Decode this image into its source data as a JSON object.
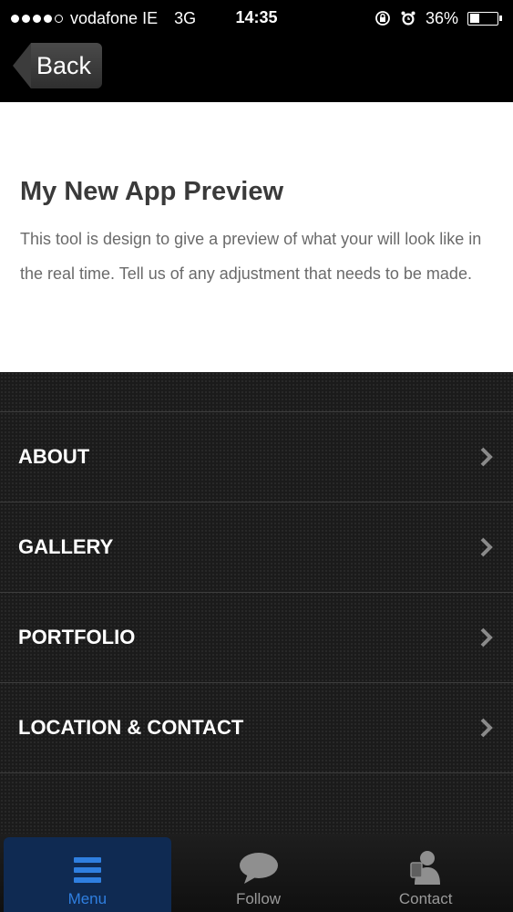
{
  "status_bar": {
    "carrier": "vodafone IE",
    "network": "3G",
    "time": "14:35",
    "battery": "36%",
    "battery_level": 0.36
  },
  "nav": {
    "back_label": "Back"
  },
  "intro": {
    "title": "My New App Preview",
    "body": "This tool is design to give a preview of what your will look like in the real time. Tell us of any adjustment that needs to be made."
  },
  "menu": {
    "items": [
      {
        "label": "ABOUT",
        "icon": "chevron-right-icon"
      },
      {
        "label": "GALLERY",
        "icon": "chevron-right-icon"
      },
      {
        "label": "PORTFOLIO",
        "icon": "chevron-right-icon"
      },
      {
        "label": "LOCATION & CONTACT",
        "icon": "chevron-right-icon"
      }
    ]
  },
  "tab_bar": {
    "tabs": [
      {
        "label": "Menu",
        "icon": "menu-icon",
        "active": true
      },
      {
        "label": "Follow",
        "icon": "speech-bubble-icon",
        "active": false
      },
      {
        "label": "Contact",
        "icon": "contact-person-icon",
        "active": false
      }
    ]
  },
  "colors": {
    "active_tab": "#2f7fe0",
    "active_tab_bg": "#0f2a52"
  }
}
